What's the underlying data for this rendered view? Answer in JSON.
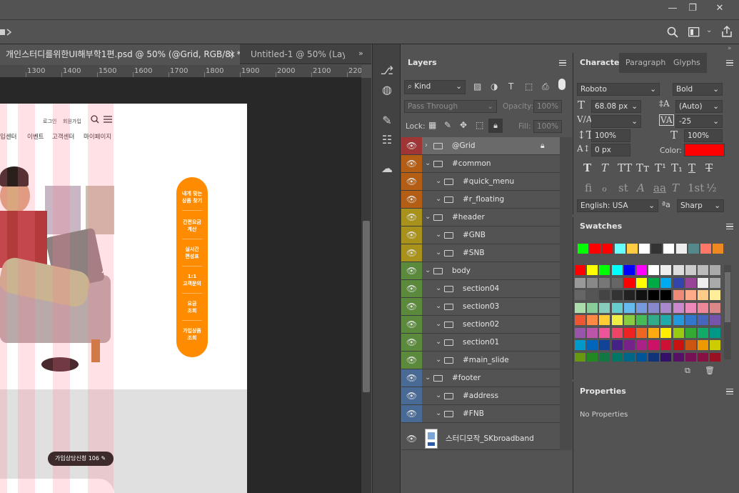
{
  "window": {
    "minimize": "—",
    "restore": "❐",
    "close": "✕"
  },
  "tabs": [
    {
      "label": "개인스터디를위한UI해부학1편.psd @ 50% (@Grid, RGB/8) *",
      "close": "×"
    },
    {
      "label": "Untitled-1 @ 50% (Layer"
    }
  ],
  "ruler": {
    "labels": [
      "1300",
      "1400",
      "1500",
      "1600",
      "1700",
      "1800",
      "1900",
      "2000",
      "2100",
      "220"
    ]
  },
  "document": {
    "util_links": [
      "로그인",
      "회원가입"
    ],
    "nav": [
      "입센터",
      "이벤트",
      "고객센터",
      "마이페이지"
    ],
    "quick_menu": [
      "내게 맞는\n상품 찾기",
      "간편요금\n계산",
      "실시간\n편성표",
      "1:1\n고객문의",
      "요금\n조회",
      "가입상품\n조회"
    ],
    "consult_button": "가입상담신청 106"
  },
  "layers_panel": {
    "tab": "Layers",
    "filter_kind": "Kind",
    "blend_mode": "Pass Through",
    "opacity_label": "Opacity:",
    "opacity_value": "100%",
    "lock_label": "Lock:",
    "fill_label": "Fill:",
    "fill_value": "100%",
    "layers": [
      {
        "name": "@Grid",
        "color": "#a03535",
        "indent": 0,
        "locked": true,
        "selected": true
      },
      {
        "name": "#common",
        "color": "#b35e14",
        "indent": 0
      },
      {
        "name": "#quick_menu",
        "color": "#b35e14",
        "indent": 1
      },
      {
        "name": "#r_floating",
        "color": "#b35e14",
        "indent": 1
      },
      {
        "name": "#header",
        "color": "#a8921c",
        "indent": 0
      },
      {
        "name": "#GNB",
        "color": "#a8921c",
        "indent": 1
      },
      {
        "name": "#SNB",
        "color": "#a8921c",
        "indent": 1
      },
      {
        "name": "body",
        "color": "#5c8a3c",
        "indent": 0
      },
      {
        "name": "section04",
        "color": "#5c8a3c",
        "indent": 1
      },
      {
        "name": "section03",
        "color": "#5c8a3c",
        "indent": 1
      },
      {
        "name": "section02",
        "color": "#5c8a3c",
        "indent": 1
      },
      {
        "name": "section01",
        "color": "#5c8a3c",
        "indent": 1
      },
      {
        "name": "#main_slide",
        "color": "#5c8a3c",
        "indent": 1
      },
      {
        "name": "#footer",
        "color": "#4a6a96",
        "indent": 0
      },
      {
        "name": "#address",
        "color": "#4a6a96",
        "indent": 1
      },
      {
        "name": "#FNB",
        "color": "#4a6a96",
        "indent": 1
      }
    ],
    "smart_layer": "스터디모작_SKbroadband"
  },
  "character_panel": {
    "tabs": [
      "Character",
      "Paragraph",
      "Glyphs"
    ],
    "font_family": "Roboto",
    "font_style": "Bold",
    "font_size": "68.08 px",
    "leading": "(Auto)",
    "kerning": "",
    "tracking": "-25",
    "vertical_scale": "100%",
    "horizontal_scale": "100%",
    "baseline_shift": "0 px",
    "color_label": "Color:",
    "color": "#ff0000",
    "language": "English: USA",
    "aa_label": "ªa",
    "antialias": "Sharp",
    "type_buttons_1": [
      "T",
      "T",
      "TT",
      "Tт",
      "T¹",
      "T₁",
      "T",
      "T"
    ],
    "type_buttons_2": [
      "fi",
      "ℴ",
      "st",
      "A",
      "aa",
      "T",
      "1st",
      "½"
    ]
  },
  "swatches_panel": {
    "tab": "Swatches",
    "recent": [
      "#00ff00",
      "#ff0000",
      "#ff0000",
      "#66ffff",
      "#ffcc44",
      "#ffffff",
      "#333333",
      "#ffffff",
      "#eeeeee",
      "#558888",
      "#ff7766",
      "#ee8822"
    ],
    "grid": [
      [
        "#ff0000",
        "#ffff00",
        "#00ff00",
        "#00ffff",
        "#0000ff",
        "#ff00ff",
        "#ffffff",
        "#eeeeee",
        "#dddddd",
        "#cccccc",
        "#bbbbbb",
        "#aaaaaa"
      ],
      [
        "#999999",
        "#888888",
        "#777777",
        "#666666",
        "#ff0000",
        "#ffff00",
        "#00aa44",
        "#00aaee",
        "#3344aa",
        "#994499",
        "#eeeeee",
        "#aaaaaa"
      ],
      [
        "#666666",
        "#555555",
        "#444444",
        "#333333",
        "#222222",
        "#111111",
        "#000000",
        "#000000",
        "#ee8877",
        "#ffaa88",
        "#ffcc88",
        "#ffee99"
      ],
      [
        "#aaddaa",
        "#88cc99",
        "#88ccbb",
        "#66cccc",
        "#66bbee",
        "#7799dd",
        "#8888cc",
        "#aa88cc",
        "#cc88cc",
        "#ee88bb",
        "#ee8899",
        "#dd8888"
      ],
      [
        "#ee5533",
        "#ff8844",
        "#ffcc33",
        "#eeee44",
        "#88cc44",
        "#44bb55",
        "#33aa88",
        "#22aaaa",
        "#2299dd",
        "#3377cc",
        "#4466bb",
        "#7755aa"
      ],
      [
        "#9955aa",
        "#bb55aa",
        "#ee5599",
        "#ee4466",
        "#ee2222",
        "#ee6622",
        "#ffaa11",
        "#ffee00",
        "#99cc11",
        "#33aa33",
        "#11aa66",
        "#009988"
      ],
      [
        "#0099cc",
        "#0066bb",
        "#114499",
        "#442288",
        "#772288",
        "#aa2288",
        "#cc1166",
        "#cc1133",
        "#cc1111",
        "#cc5511",
        "#ee9900",
        "#cccc00"
      ],
      [
        "#669911",
        "#228822",
        "#117744",
        "#007766",
        "#006688",
        "#005599",
        "#113377",
        "#331166",
        "#551166",
        "#771155",
        "#881144",
        "#991122"
      ]
    ]
  },
  "properties_panel": {
    "tab": "Properties",
    "empty": "No Properties"
  }
}
